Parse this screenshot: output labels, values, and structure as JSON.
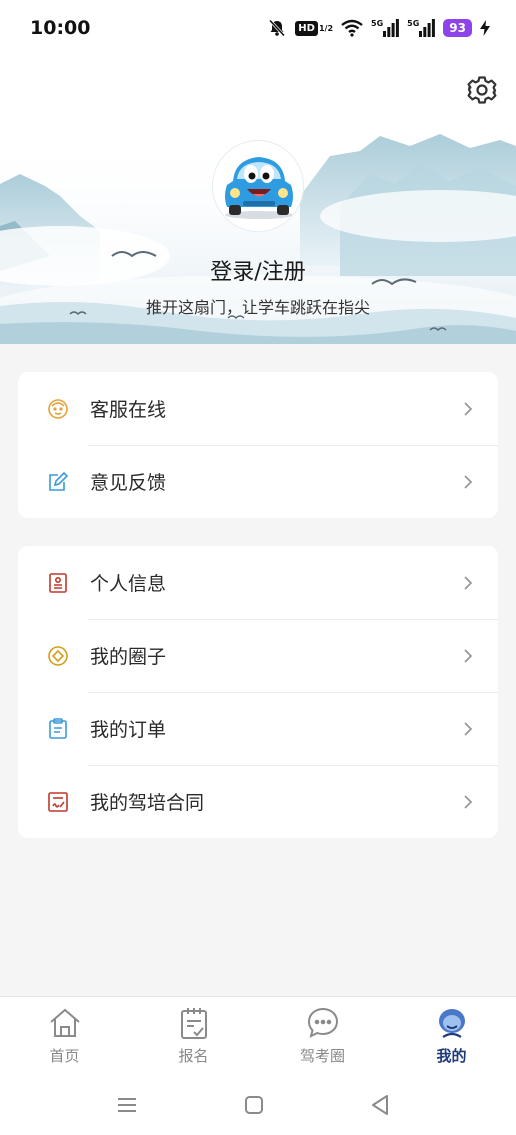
{
  "status_bar": {
    "time": "10:00",
    "hd_label": "HD",
    "hd_sub": "1/2",
    "net1": "5G",
    "net2": "5G",
    "battery": "93",
    "icons": [
      "mute-bell-icon",
      "wifi-icon",
      "signal-icon",
      "charging-icon"
    ]
  },
  "header": {
    "login_title": "登录/注册",
    "slogan": "推开这扇门，让学车跳跃在指尖",
    "settings_icon": "gear-icon",
    "avatar_icon": "cartoon-car-avatar"
  },
  "card1": {
    "items": [
      {
        "label": "客服在线",
        "icon": "customer-service-icon",
        "color": "#e6a23c"
      },
      {
        "label": "意见反馈",
        "icon": "edit-note-icon",
        "color": "#3a9ad9"
      }
    ]
  },
  "card2": {
    "items": [
      {
        "label": "个人信息",
        "icon": "id-card-icon",
        "color": "#c0392b"
      },
      {
        "label": "我的圈子",
        "icon": "circle-icon",
        "color": "#d4a017"
      },
      {
        "label": "我的订单",
        "icon": "clipboard-icon",
        "color": "#3a9ad9"
      },
      {
        "label": "我的驾培合同",
        "icon": "contract-icon",
        "color": "#c0392b"
      }
    ]
  },
  "bottom_nav": {
    "items": [
      {
        "label": "首页",
        "icon": "home-icon",
        "active": false
      },
      {
        "label": "报名",
        "icon": "signup-clipboard-icon",
        "active": false
      },
      {
        "label": "驾考圈",
        "icon": "chat-bubble-icon",
        "active": false
      },
      {
        "label": "我的",
        "icon": "user-face-icon",
        "active": true
      }
    ],
    "active_color": "#1e3a7a"
  },
  "system_nav": {
    "icons": [
      "menu-icon",
      "home-square-icon",
      "back-triangle-icon"
    ]
  }
}
